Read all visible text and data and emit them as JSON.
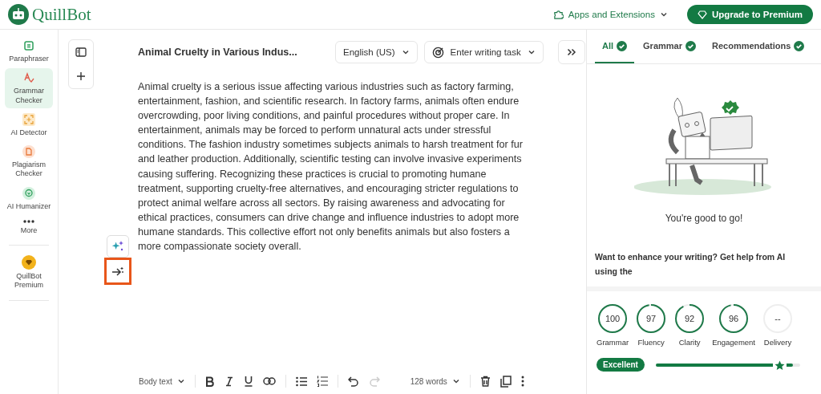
{
  "header": {
    "logo": "QuillBot",
    "apps": "Apps and Extensions",
    "upgrade": "Upgrade to Premium"
  },
  "sidebar": {
    "items": [
      {
        "kind": "paraphraser",
        "label": "Paraphraser",
        "selected": false
      },
      {
        "kind": "grammar",
        "label": "Grammar Checker",
        "selected": true
      },
      {
        "kind": "detector",
        "label": "AI Detector",
        "selected": false
      },
      {
        "kind": "plagiarism",
        "label": "Plagiarism Checker",
        "selected": false
      },
      {
        "kind": "humanizer",
        "label": "AI Humanizer",
        "selected": false
      },
      {
        "kind": "more",
        "label": "More",
        "selected": false
      }
    ],
    "premium": "QuillBot Premium"
  },
  "editor": {
    "title": "Animal Cruelty in Various Indus...",
    "language": "English (US)",
    "task_placeholder": "Enter writing task",
    "text": "Animal cruelty is a serious issue affecting various industries such as factory farming, entertainment, fashion, and scientific research. In factory farms, animals often endure overcrowding, poor living conditions, and painful procedures without proper care. In entertainment, animals may be forced to perform unnatural acts under stressful conditions. The fashion industry sometimes subjects animals to harsh treatment for fur and leather production. Additionally, scientific testing can involve invasive experiments causing suffering. Recognizing these practices is crucial to promoting humane treatment, supporting cruelty-free alternatives, and encouraging stricter regulations to protect animal welfare across all sectors. By raising awareness and advocating for ethical practices, consumers can drive change and influence industries to adopt more humane standards. This collective effort not only benefits animals but also fosters a more compassionate society overall.",
    "side_tools": [
      {
        "kind": "sparkle",
        "highlighted": false
      },
      {
        "kind": "arrow",
        "highlighted": true
      }
    ]
  },
  "toolbar": {
    "style": "Body text",
    "words": "128 words",
    "undo_disabled": false,
    "redo_disabled": true
  },
  "panel": {
    "tabs": [
      {
        "label": "All",
        "selected": true
      },
      {
        "label": "Grammar",
        "selected": false
      },
      {
        "label": "Recommendations",
        "selected": false
      }
    ],
    "status": "You're good to go!",
    "enhance": "Want to enhance your writing? Get help from AI using the",
    "scores": [
      {
        "value": "100",
        "label": "Grammar"
      },
      {
        "value": "97",
        "label": "Fluency"
      },
      {
        "value": "92",
        "label": "Clarity"
      },
      {
        "value": "96",
        "label": "Engagement"
      },
      {
        "value": "--",
        "label": "Delivery"
      }
    ],
    "rating": "Excellent",
    "level": 0.95
  }
}
